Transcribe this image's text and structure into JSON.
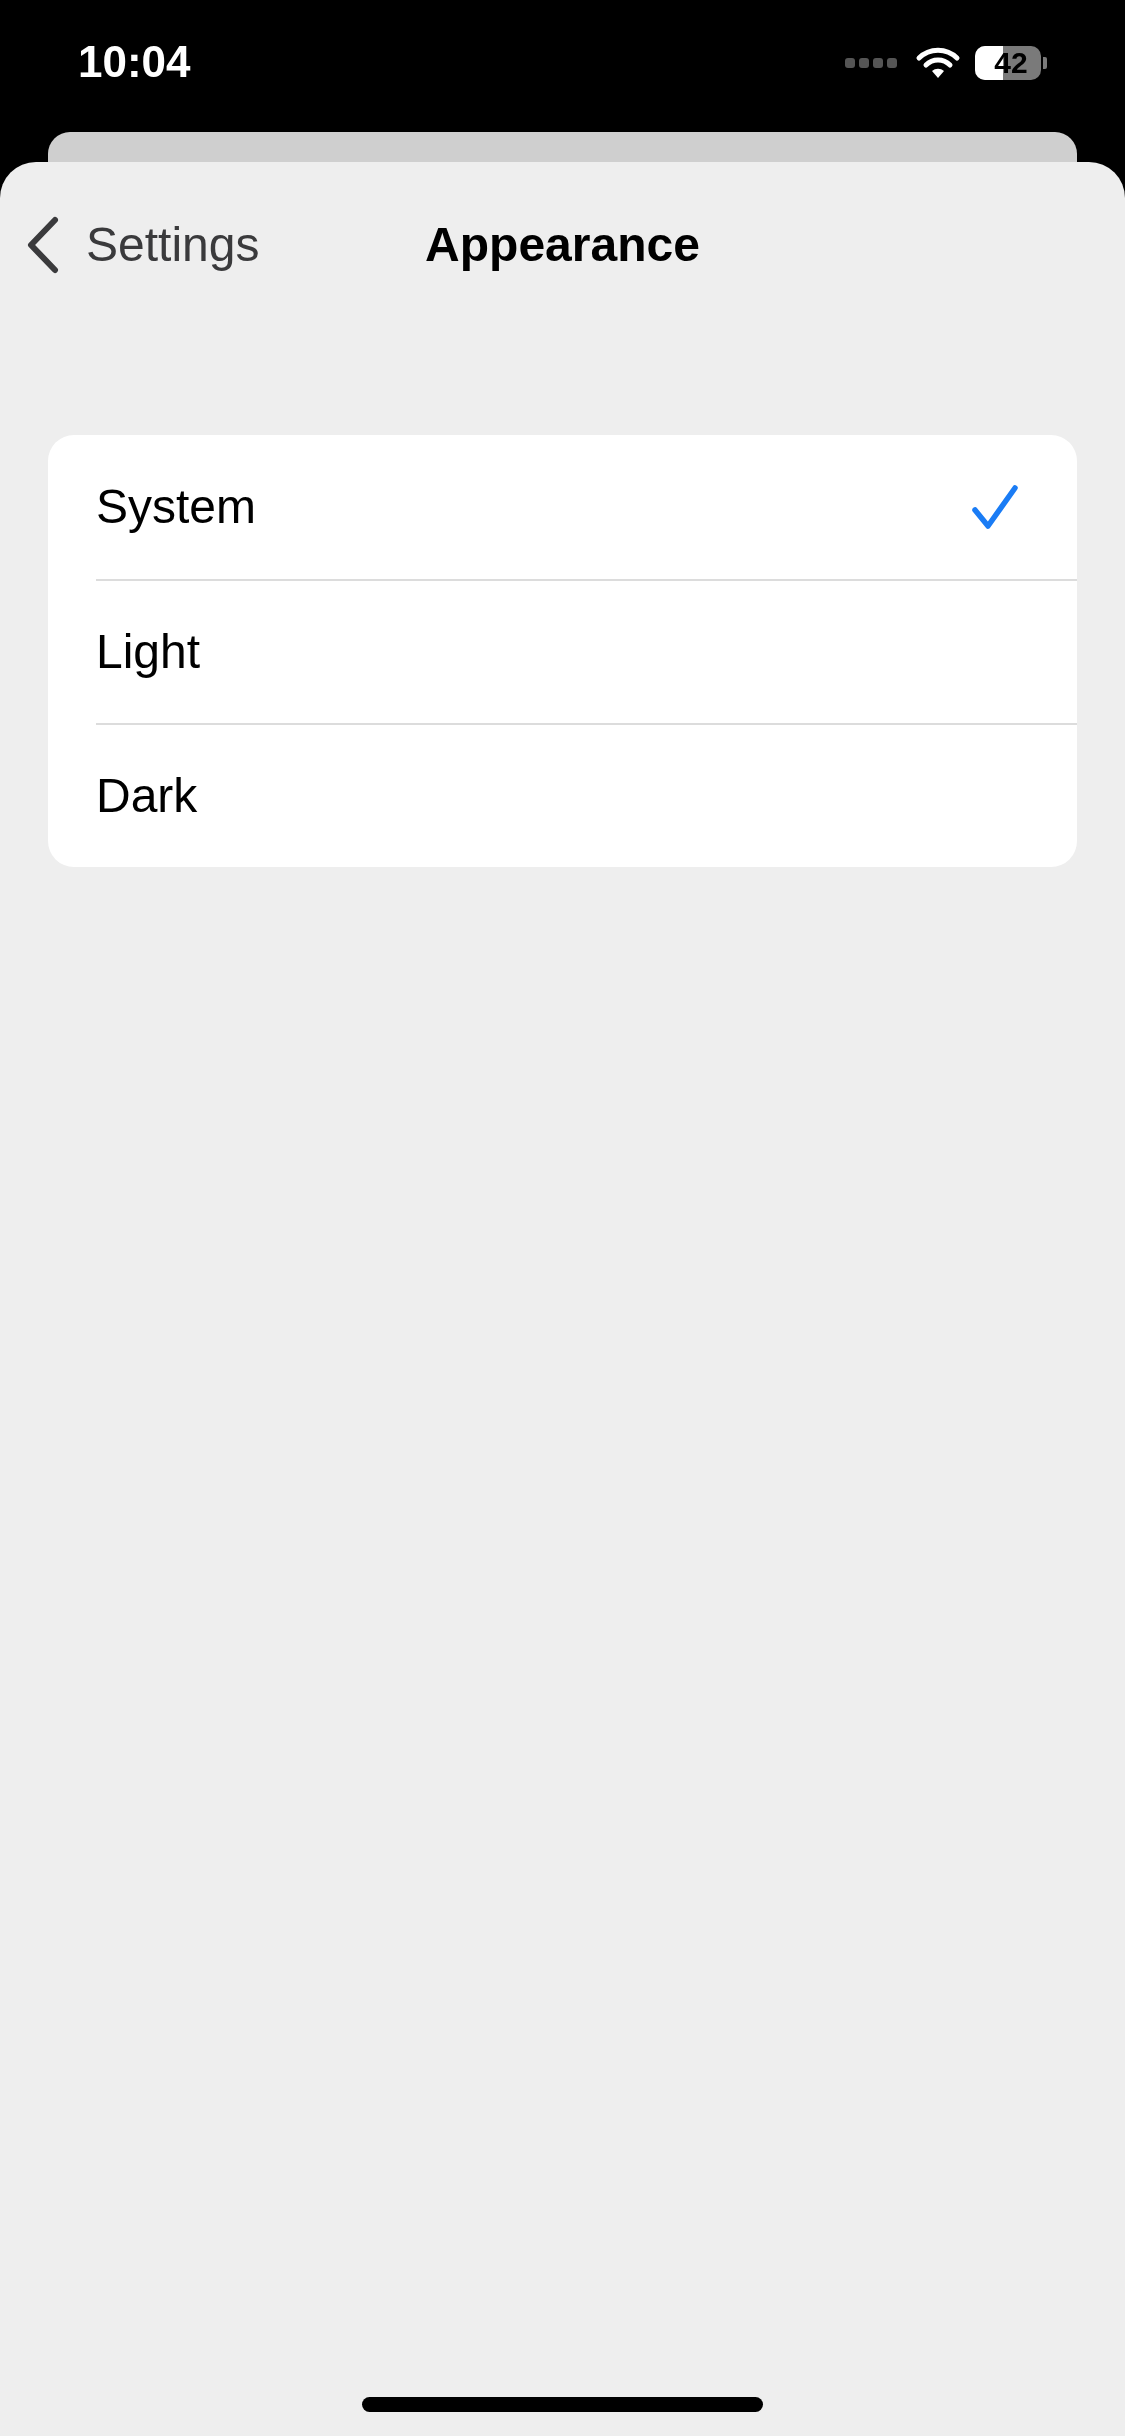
{
  "status_bar": {
    "time": "10:04",
    "battery": "42"
  },
  "nav": {
    "back": "Settings",
    "title": "Appearance"
  },
  "options": [
    {
      "label": "System",
      "selected": true
    },
    {
      "label": "Light",
      "selected": false
    },
    {
      "label": "Dark",
      "selected": false
    }
  ]
}
